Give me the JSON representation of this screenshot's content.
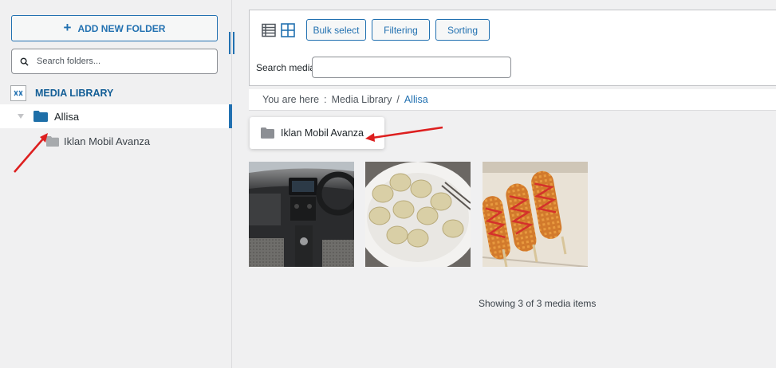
{
  "sidebar": {
    "add_folder_label": "ADD NEW FOLDER",
    "search_placeholder": "Search folders...",
    "media_library_label": "MEDIA LIBRARY",
    "active_folder": "Allisa",
    "child_folder": "Iklan Mobil Avanza"
  },
  "toolbar": {
    "bulk_select": "Bulk select",
    "filtering": "Filtering",
    "sorting": "Sorting",
    "search_media_label": "Search media",
    "search_media_value": ""
  },
  "breadcrumb": {
    "prefix": "You are here",
    "separator1": ":",
    "library": "Media Library",
    "separator2": "/",
    "current": "Allisa"
  },
  "content": {
    "folder_card_label": "Iklan Mobil Avanza",
    "media_items": [
      {
        "name": "car-interior-image"
      },
      {
        "name": "dumplings-image"
      },
      {
        "name": "corn-dogs-image"
      }
    ],
    "showing_text": "Showing 3 of 3 media items"
  },
  "colors": {
    "accent": "#2271b1",
    "folder_blue": "#1e6fa8",
    "folder_gray": "#8c8f94",
    "annotation_arrow": "#dd1f1f"
  }
}
